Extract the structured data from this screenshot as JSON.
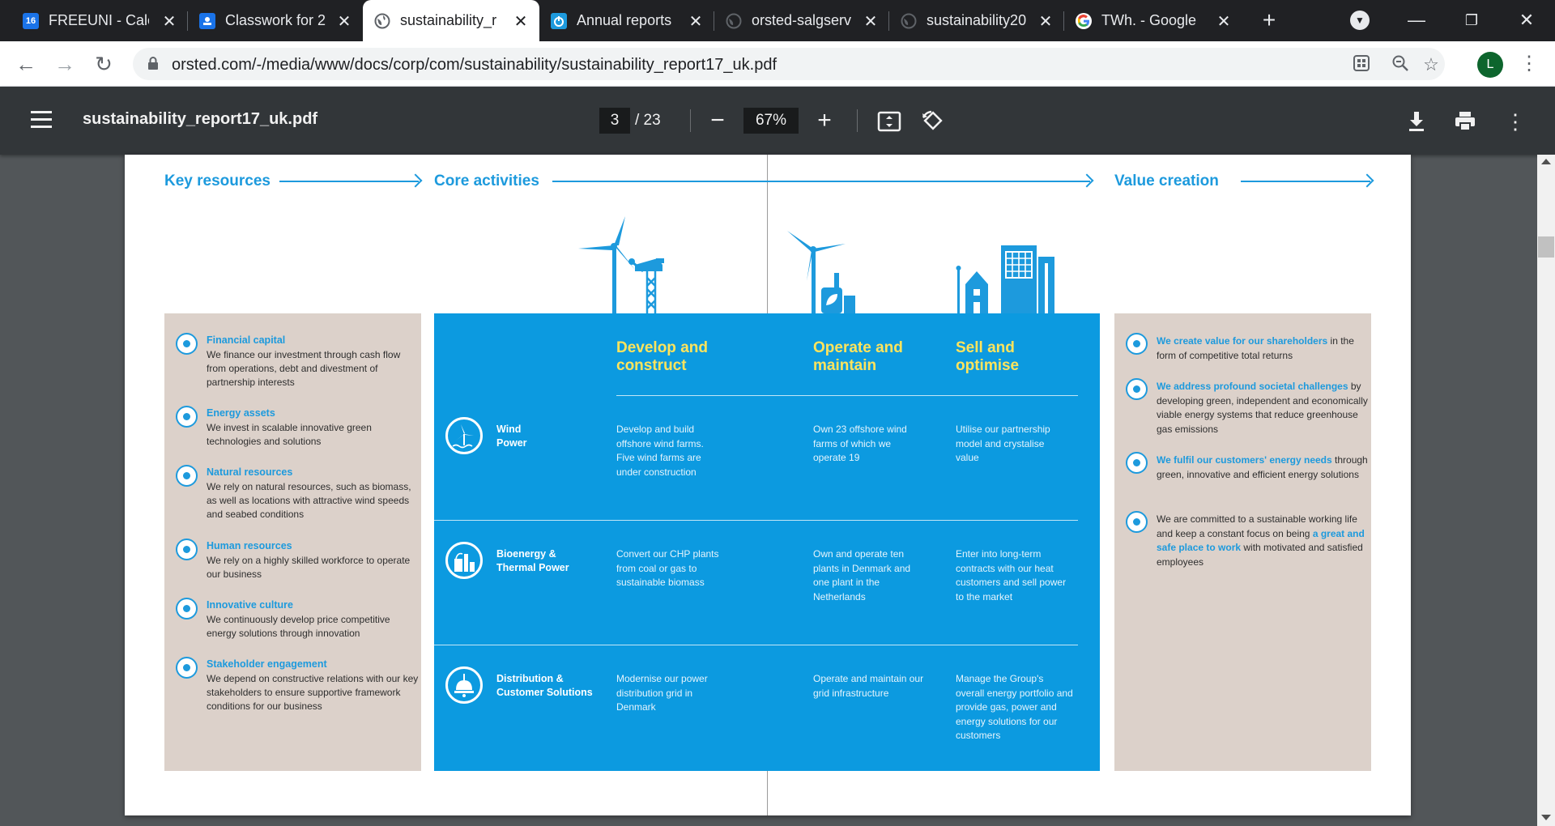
{
  "browser": {
    "tabs": [
      {
        "title": "FREEUNI - Cale",
        "favicon": "calendar-16-icon",
        "favicon_text": "16"
      },
      {
        "title": "Classwork for 2",
        "favicon": "classroom-icon"
      },
      {
        "title": "sustainability_r",
        "favicon": "globe-icon"
      },
      {
        "title": "Annual reports",
        "favicon": "power-icon"
      },
      {
        "title": "orsted-salgserv",
        "favicon": "globe-icon"
      },
      {
        "title": "sustainability20",
        "favicon": "globe-icon"
      },
      {
        "title": "TWh. - Google",
        "favicon": "google-icon"
      }
    ],
    "active_tab_index": 2,
    "url": "orsted.com/-/media/www/docs/corp/com/sustainability/sustainability_report17_uk.pdf",
    "profile_initial": "L"
  },
  "pdf_viewer": {
    "filename": "sustainability_report17_uk.pdf",
    "current_page": "3",
    "total_pages": "/ 23",
    "zoom": "67%"
  },
  "document": {
    "headers": {
      "key_resources": "Key resources",
      "core_activities": "Core activities",
      "value_creation": "Value creation"
    },
    "key_resources": [
      {
        "title": "Financial capital",
        "text": "We finance our investment through cash flow from operations, debt and divestment of partnership interests"
      },
      {
        "title": "Energy assets",
        "text": "We invest in scalable innovative green technologies and solutions"
      },
      {
        "title": "Natural resources",
        "text": "We rely on natural resources, such as biomass, as well as locations with attractive wind speeds and seabed conditions"
      },
      {
        "title": "Human resources",
        "text": "We rely on a highly skilled workforce to operate our business"
      },
      {
        "title": "Innovative culture",
        "text": "We continuously develop price competitive energy solutions through innovation"
      },
      {
        "title": "Stakeholder engagement",
        "text": "We depend on constructive relations with our key stakeholders to ensure supportive framework conditions for our business"
      }
    ],
    "core_columns": [
      {
        "line1": "Develop and",
        "line2": "construct"
      },
      {
        "line1": "Operate and",
        "line2": "maintain"
      },
      {
        "line1": "Sell and",
        "line2": "optimise"
      }
    ],
    "core_rows": [
      {
        "label_line1": "Wind",
        "label_line2": "Power",
        "cells": [
          "Develop and build offshore wind farms. Five wind farms are under construction",
          "Own 23 offshore wind farms of which we operate 19",
          "Utilise our partnership model and crystalise value"
        ]
      },
      {
        "label_line1": "Bioenergy &",
        "label_line2": "Thermal Power",
        "cells": [
          "Convert our CHP plants from coal or gas to sustainable biomass",
          "Own and operate ten plants in Denmark and one plant in the Netherlands",
          "Enter into long-term contracts with our heat customers and sell power to the market"
        ]
      },
      {
        "label_line1": "Distribution &",
        "label_line2": "Customer Solutions",
        "cells": [
          "Modernise our power distribution grid in Denmark",
          "Operate and maintain our grid infrastructure",
          "Manage the Group's overall energy portfolio and provide gas, power and energy solutions for our customers"
        ]
      }
    ],
    "value_creation": [
      {
        "pre": "",
        "title": "We create value for our shareholders",
        "post": " in the form of competitive total returns"
      },
      {
        "pre": "",
        "title": "We address profound societal challenges",
        "post": " by developing green, independent and economically viable energy systems that reduce greenhouse gas emissions"
      },
      {
        "pre": "",
        "title": "We fulfil our customers' energy needs",
        "post": " through green, innovative and efficient energy solutions"
      },
      {
        "pre": "We are committed to a sustainable working life and keep a constant focus on being ",
        "title": "a great and safe place to work",
        "post": " with motivated and satisfied employees"
      }
    ]
  },
  "colors": {
    "accent_blue": "#1d9add",
    "panel_blue": "#0c9ae0",
    "panel_beige": "#dcd1ca",
    "heading_yellow": "#ffe45c"
  }
}
